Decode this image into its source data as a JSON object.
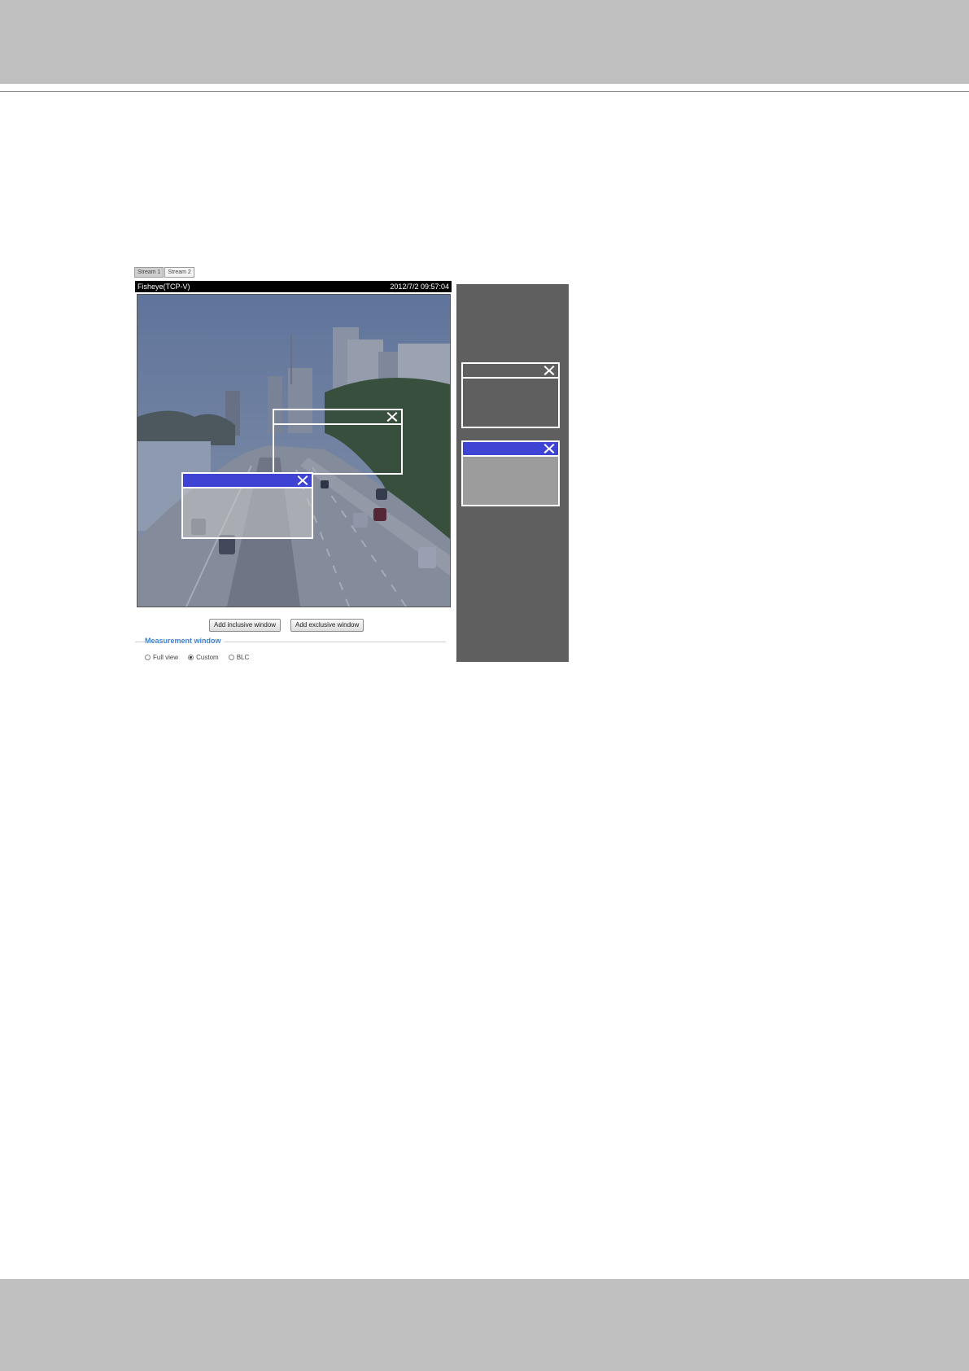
{
  "stream_tabs": [
    "Stream 1",
    "Stream 2"
  ],
  "viewer": {
    "source_label": "Fisheye(TCP-V)",
    "timestamp": "2012/7/2 09:57:04"
  },
  "buttons": {
    "add_inclusive": "Add inclusive window",
    "add_exclusive": "Add exclusive window"
  },
  "measurement": {
    "legend": "Measurement window",
    "options": [
      "Full view",
      "Custom",
      "BLC"
    ],
    "selected": "Custom"
  },
  "colors": {
    "inclusive_bar": "#3f43d4",
    "panel": "#5f5f5f",
    "band": "#c0c0c0"
  },
  "icons": {
    "close": "close-icon"
  }
}
